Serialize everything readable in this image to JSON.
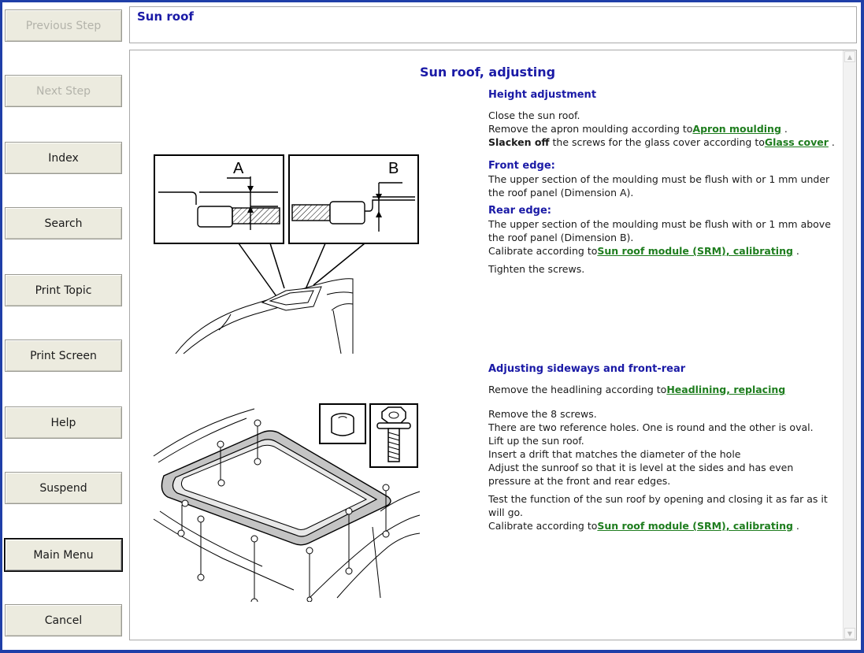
{
  "sidebar": {
    "buttons": [
      {
        "label": "Previous Step",
        "enabled": false
      },
      {
        "label": "Next Step",
        "enabled": false
      },
      {
        "label": "Index",
        "enabled": true
      },
      {
        "label": "Search",
        "enabled": true
      },
      {
        "label": "Print Topic",
        "enabled": true
      },
      {
        "label": "Print Screen",
        "enabled": true
      },
      {
        "label": "Help",
        "enabled": true
      },
      {
        "label": "Suspend",
        "enabled": true
      },
      {
        "label": "Main Menu",
        "enabled": true,
        "focused": true
      },
      {
        "label": "Cancel",
        "enabled": true
      }
    ]
  },
  "header": {
    "title": "Sun roof"
  },
  "doc": {
    "title": "Sun roof, adjusting",
    "height": {
      "heading": "Height adjustment",
      "line1": "Close the sun roof.",
      "line2_pre": "Remove the apron moulding according to",
      "line2_link": "Apron moulding",
      "line2_post": " .",
      "line3_bold": "Slacken off",
      "line3_pre": " the screws for the glass cover according to",
      "line3_link": "Glass cover",
      "line3_post": " .",
      "front_heading": "Front edge:",
      "front_text": "The upper section of the moulding must be flush with or 1 mm under the roof panel (Dimension A).",
      "rear_heading": "Rear edge:",
      "rear_text": "The upper section of the moulding must be flush with or 1 mm above the roof panel (Dimension B).",
      "calib_pre": "Calibrate according to",
      "calib_link": "Sun roof module (SRM), calibrating",
      "calib_post": " .",
      "tighten": "Tighten the screws."
    },
    "sideways": {
      "heading": "Adjusting sideways and front-rear",
      "headlining_pre": "Remove the headlining according to",
      "headlining_link": "Headlining, replacing",
      "l1": "Remove the 8 screws.",
      "l2": "There are two reference holes. One is round and the other is oval.",
      "l3": "Lift up the sun roof.",
      "l4": "Insert a drift that matches the diameter of the hole",
      "l5": "Adjust the sunroof so that it is level at the sides and has even pressure at the front and rear edges.",
      "l6": "Test the function of the sun roof by opening and closing it as far as it will go.",
      "calib_pre": "Calibrate according to",
      "calib_link": "Sun roof module (SRM), calibrating",
      "calib_post": " ."
    },
    "figure1": {
      "label_a": "A",
      "label_b": "B"
    }
  },
  "colors": {
    "accent": "#1a1aa6",
    "link": "#1e7d1e",
    "frame": "#1f3fa8",
    "button_bg": "#ecebdf"
  }
}
